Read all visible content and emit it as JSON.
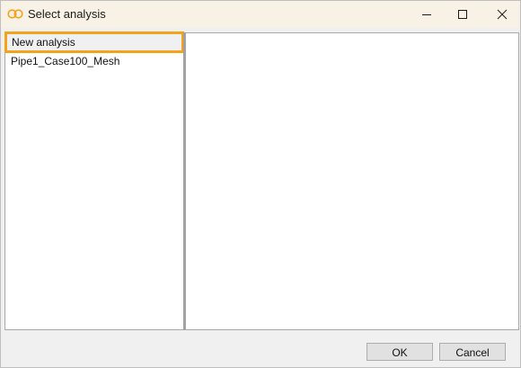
{
  "window": {
    "title": "Select analysis",
    "accent_color": "#f3a21c",
    "titlebar_color": "#f8f1e6"
  },
  "analysis_list": {
    "items": [
      {
        "label": "New analysis",
        "selected": true
      },
      {
        "label": "Pipe1_Case100_Mesh",
        "selected": false
      }
    ]
  },
  "buttons": {
    "ok_label": "OK",
    "cancel_label": "Cancel"
  },
  "icons": {
    "app": "app-logo-icon",
    "minimize": "minimize-icon",
    "maximize": "maximize-icon",
    "close": "close-icon"
  }
}
